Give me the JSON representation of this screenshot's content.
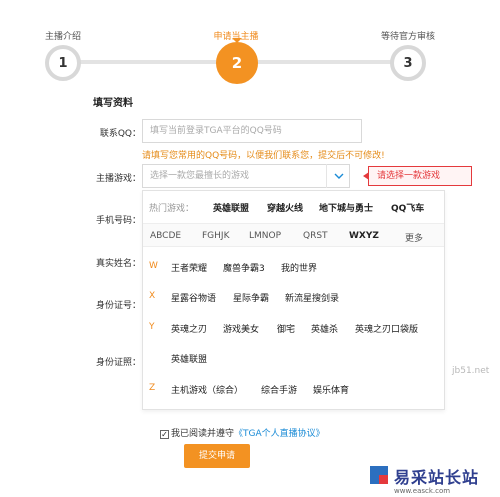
{
  "steps": [
    {
      "label": "主播介绍",
      "number": "1"
    },
    {
      "label": "申请当主播",
      "number": "2"
    },
    {
      "label": "等待官方审核",
      "number": "3"
    }
  ],
  "section_title": "填写资料",
  "form": {
    "qq_label": "联系QQ：",
    "qq_placeholder": "填写当前登录TGA平台的QQ号码",
    "qq_hint": "请填写您常用的QQ号码，以便我们联系您，提交后不可修改!",
    "game_label": "主播游戏：",
    "game_placeholder": "选择一款您最擅长的游戏",
    "game_error": "请选择一款游戏",
    "phone_label": "手机号码：",
    "realname_label": "真实姓名：",
    "idnum_label": "身份证号：",
    "idphoto_label": "身份证照："
  },
  "dropdown": {
    "hot_title": "热门游戏：",
    "hot_games": [
      "英雄联盟",
      "穿越火线",
      "地下城与勇士",
      "QQ飞车"
    ],
    "letter_tabs": [
      "ABCDE",
      "FGHJK",
      "LMNOP",
      "QRST",
      "WXYZ",
      "更多"
    ],
    "groups": [
      {
        "letter": "W",
        "games": [
          "王者荣耀",
          "魔兽争霸3",
          "我的世界"
        ]
      },
      {
        "letter": "X",
        "games": [
          "星露谷物语",
          "星际争霸",
          "新流星搜剑录"
        ]
      },
      {
        "letter": "Y",
        "games": [
          "英魂之刃",
          "游戏美女",
          "御宅",
          "英雄杀",
          "英魂之刃口袋版",
          "英雄联盟"
        ]
      },
      {
        "letter": "Z",
        "games": [
          "主机游戏（综合）",
          "综合手游",
          "娱乐体育"
        ]
      }
    ]
  },
  "agreement": {
    "checkbox_mark": "✓",
    "prefix": "我已阅读并遵守",
    "link": "《TGA个人直播协议》"
  },
  "submit_label": "提交申请",
  "watermark": "jb51.net",
  "logo": {
    "text": "易采站长站",
    "url": "www.easck.com"
  },
  "colors": {
    "accent": "#f39222",
    "link": "#1a8bd6",
    "error": "#e4393c"
  }
}
